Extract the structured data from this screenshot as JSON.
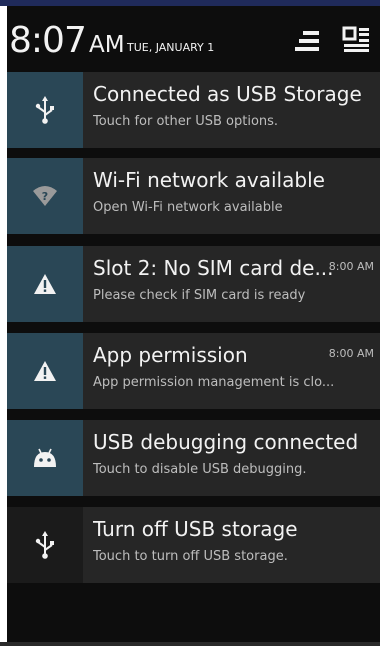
{
  "header": {
    "time": "8:07",
    "ampm": "AM",
    "date": "TUE, JANUARY 1",
    "quick_settings_icon": "quick-settings-icon",
    "clear_icon": "clear-notifications-icon"
  },
  "notifications": [
    {
      "icon": "usb-icon",
      "title": "Connected as USB Storage",
      "subtitle": "Touch for other USB options.",
      "time": ""
    },
    {
      "icon": "wifi-icon",
      "title": "Wi-Fi network available",
      "subtitle": "Open Wi-Fi network available",
      "time": ""
    },
    {
      "icon": "warning-icon",
      "title": "Slot 2: No SIM card de...",
      "subtitle": "Please check if SIM card is ready",
      "time": "8:00 AM"
    },
    {
      "icon": "warning-icon",
      "title": "App permission",
      "subtitle": "App permission management is clo...",
      "time": "8:00 AM"
    },
    {
      "icon": "android-debug-icon",
      "title": "USB debugging connected",
      "subtitle": "Touch to disable USB debugging.",
      "time": ""
    },
    {
      "icon": "usb-icon",
      "title": "Turn off USB storage",
      "subtitle": "Touch to turn off USB storage.",
      "time": ""
    }
  ],
  "colors": {
    "background": "#0d0d0d",
    "card": "#262626",
    "icon_box": "#2a4756",
    "text_primary": "#f2f2f2",
    "text_secondary": "#bdbdbd"
  }
}
